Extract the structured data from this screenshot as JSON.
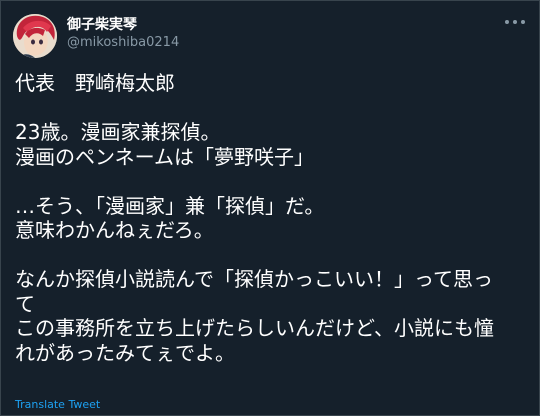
{
  "user": {
    "display_name": "御子柴実琴",
    "handle": "@mikoshiba0214",
    "avatar_icon": "avatar-image"
  },
  "tweet": {
    "lines": [
      "代表　野崎梅太郎",
      "",
      "23歳。漫画家兼探偵。",
      "漫画のペンネームは「夢野咲子」",
      "",
      "…そう、「漫画家」兼「探偵」だ。",
      "意味わかんねぇだろ。",
      "",
      "なんか探偵小説読んで「探偵かっこいい！」って思っ",
      "て",
      "この事務所を立ち上げたらしいんだけど、小説にも憧",
      "れがあったみてぇでよ。"
    ]
  },
  "actions": {
    "more_icon": "more-horizontal-icon",
    "translate_label": "Translate Tweet"
  },
  "colors": {
    "background": "#15202b",
    "text": "#ffffff",
    "muted": "#8899a6",
    "link": "#1da1f2"
  }
}
